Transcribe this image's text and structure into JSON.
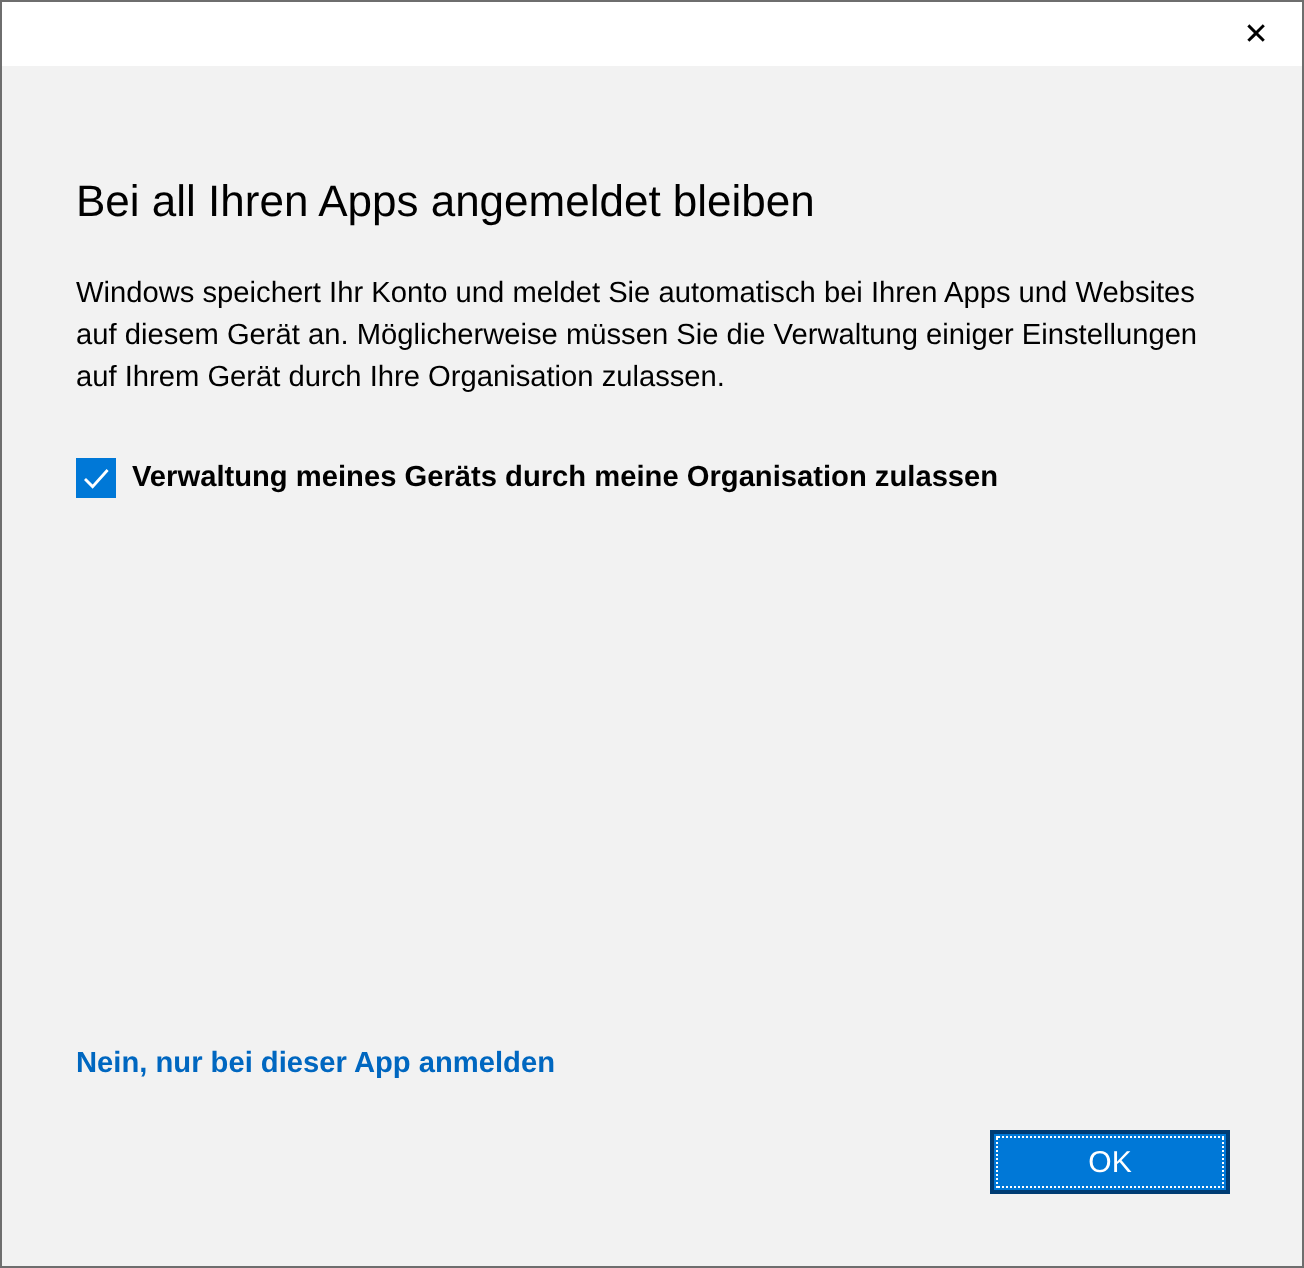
{
  "window": {
    "close": "✕"
  },
  "heading": "Bei all Ihren Apps angemeldet bleiben",
  "description": "Windows speichert Ihr Konto und meldet Sie automatisch bei Ihren Apps und Websites auf diesem Gerät an. Möglicherweise müssen Sie die Verwaltung einiger Einstellungen auf Ihrem Gerät durch Ihre Organisation zulassen.",
  "checkbox": {
    "label": "Verwaltung meines Geräts durch meine Organisation zulassen",
    "checked": true
  },
  "link": "Nein, nur bei dieser App anmelden",
  "buttons": [
    "OK"
  ]
}
